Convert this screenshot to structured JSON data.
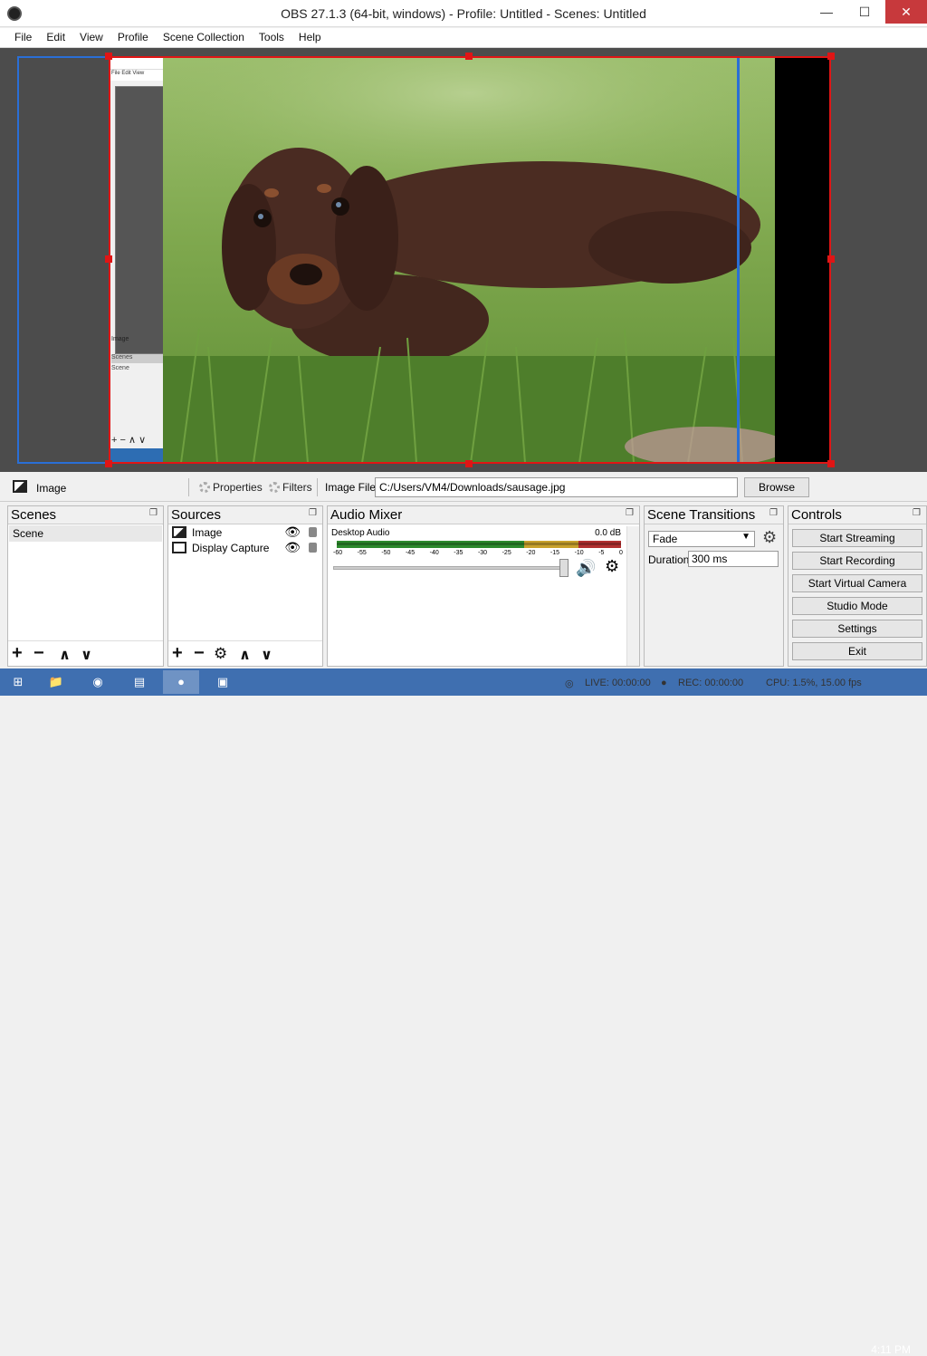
{
  "window": {
    "title": "OBS 27.1.3 (64-bit, windows) - Profile: Untitled - Scenes: Untitled",
    "minimize": "—",
    "maximize": "☐",
    "close": "✕"
  },
  "menu": [
    "File",
    "Edit",
    "View",
    "Profile",
    "Scene Collection",
    "Tools",
    "Help"
  ],
  "mini_preview": {
    "menu": "File  Edit  View",
    "image_label": "Image",
    "scenes_label": "Scenes",
    "scene_item": "Scene",
    "tools": "+ −  ∧ ∨"
  },
  "source_toolbar": {
    "selected_source": "Image",
    "properties": "Properties",
    "filters": "Filters",
    "file_label": "Image File",
    "file_path": "C:/Users/VM4/Downloads/sausage.jpg",
    "browse": "Browse"
  },
  "docks": {
    "scenes": {
      "title": "Scenes",
      "items": [
        "Scene"
      ]
    },
    "sources": {
      "title": "Sources",
      "items": [
        {
          "name": "Image"
        },
        {
          "name": "Display Capture"
        }
      ]
    },
    "mixer": {
      "title": "Audio Mixer",
      "channel": "Desktop Audio",
      "level": "0.0 dB",
      "ticks": [
        "-60",
        "-55",
        "-50",
        "-45",
        "-40",
        "-35",
        "-30",
        "-25",
        "-20",
        "-15",
        "-10",
        "-5",
        "0"
      ]
    },
    "transitions": {
      "title": "Scene Transitions",
      "selected": "Fade",
      "duration_label": "Duration",
      "duration": "300 ms"
    },
    "controls": {
      "title": "Controls",
      "buttons": [
        "Start Streaming",
        "Start Recording",
        "Start Virtual Camera",
        "Studio Mode",
        "Settings",
        "Exit"
      ]
    }
  },
  "status": {
    "live": "LIVE: 00:00:00",
    "rec": "REC: 00:00:00",
    "cpu": "CPU: 1.5%, 15.00 fps"
  },
  "taskbar": {
    "clock": "4:11 PM"
  },
  "colors": {
    "selection": "#e01515",
    "bounds": "#2a6fd6",
    "taskbar": "#3f6fb0"
  }
}
